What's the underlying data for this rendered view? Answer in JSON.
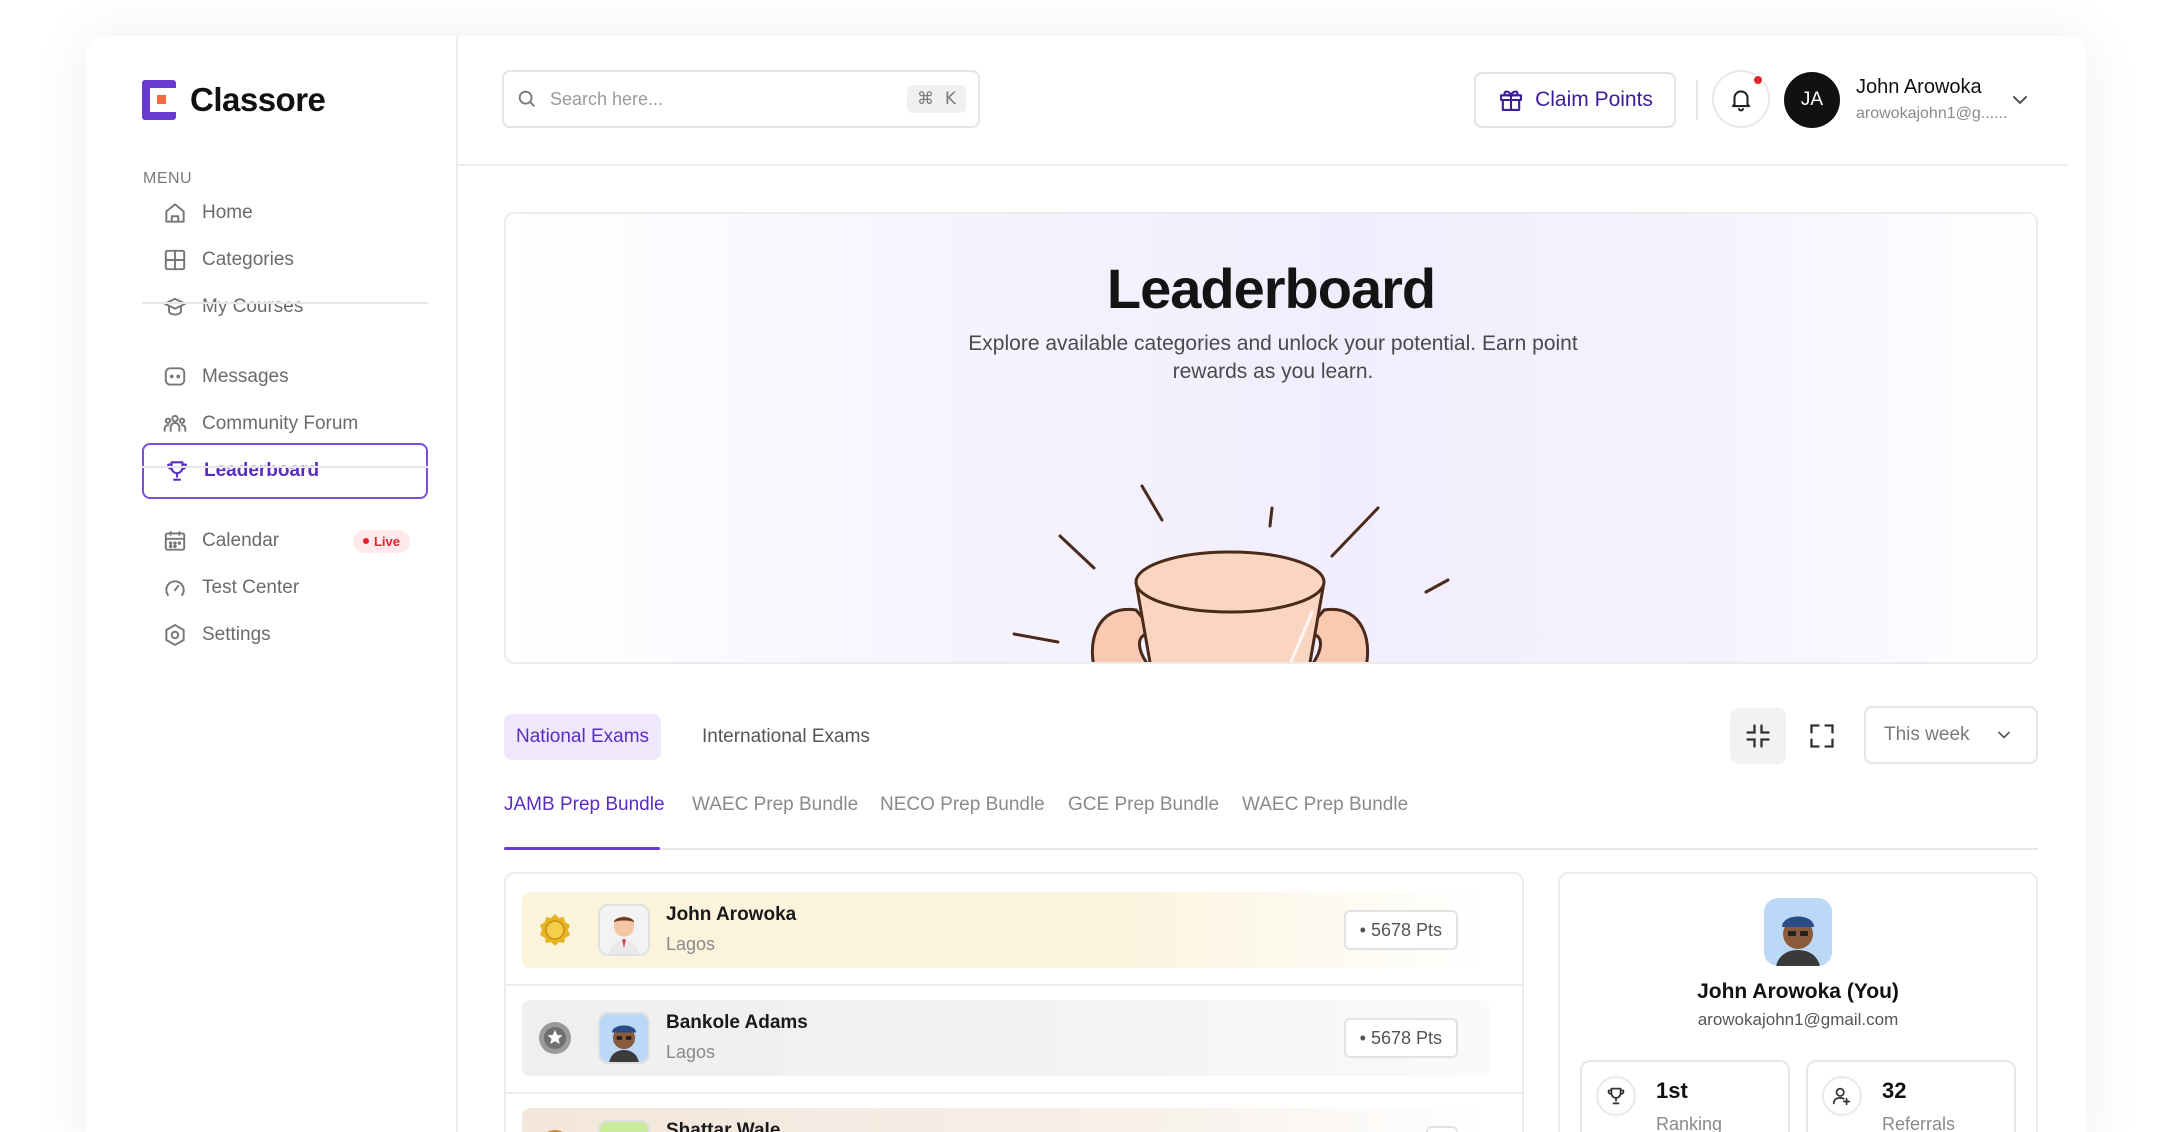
{
  "app": {
    "name": "Classore"
  },
  "sidebar": {
    "menu_label": "MENU",
    "items": [
      {
        "label": "Home",
        "icon": "home-icon"
      },
      {
        "label": "Categories",
        "icon": "grid-icon"
      },
      {
        "label": "My Courses",
        "icon": "graduation-cap-icon"
      },
      {
        "label": "Messages",
        "icon": "message-icon"
      },
      {
        "label": "Community Forum",
        "icon": "users-icon"
      },
      {
        "label": "Leaderboard",
        "icon": "trophy-icon",
        "active": true
      },
      {
        "label": "Calendar",
        "icon": "calendar-icon",
        "badge": "Live"
      },
      {
        "label": "Test Center",
        "icon": "gauge-icon"
      },
      {
        "label": "Settings",
        "icon": "settings-icon"
      }
    ]
  },
  "header": {
    "search_placeholder": "Search here...",
    "search_shortcut_symbol": "⌘",
    "search_shortcut_key": "K",
    "claim_label": "Claim Points",
    "user": {
      "initials": "JA",
      "name": "John Arowoka",
      "email": "arowokajohn1@g......"
    }
  },
  "hero": {
    "title": "Leaderboard",
    "subtitle": "Explore available categories and unlock your potential. Earn point rewards as you learn."
  },
  "exam_tabs": [
    {
      "label": "National Exams",
      "active": true
    },
    {
      "label": "International Exams",
      "active": false
    }
  ],
  "period": {
    "selected": "This week"
  },
  "bundle_tabs": [
    {
      "label": "JAMB Prep Bundle",
      "active": true
    },
    {
      "label": "WAEC Prep Bundle"
    },
    {
      "label": "NECO Prep Bundle"
    },
    {
      "label": "GCE Prep Bundle"
    },
    {
      "label": "WAEC Prep Bundle"
    }
  ],
  "leaderboard": [
    {
      "name": "John Arowoka",
      "location": "Lagos",
      "points": "• 5678 Pts",
      "medal": "gold"
    },
    {
      "name": "Bankole Adams",
      "location": "Lagos",
      "points": "• 5678 Pts",
      "medal": "silver"
    },
    {
      "name": "Shattar Wale",
      "location": "",
      "points": "",
      "medal": "bronze"
    }
  ],
  "profile": {
    "name": "John Arowoka (You)",
    "email": "arowokajohn1@gmail.com",
    "stats": [
      {
        "value": "1st",
        "label": "Ranking",
        "icon": "trophy-icon"
      },
      {
        "value": "32",
        "label": "Referrals",
        "icon": "user-plus-icon"
      }
    ]
  },
  "colors": {
    "accent": "#6a3bd0",
    "accent_dark": "#3f1c9a",
    "live_red": "#e2222f",
    "gold_row": "#fbf3dc",
    "silver_row": "#f2f2f2",
    "trophy_fill": "#fad5c2",
    "trophy_stroke": "#4a2a1a"
  }
}
